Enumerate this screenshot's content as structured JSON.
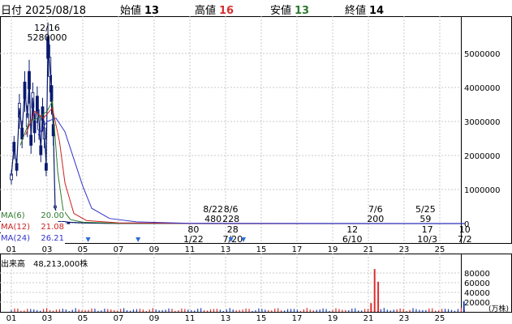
{
  "header": {
    "date": "日付 2025/08/18",
    "open_label": "始値",
    "open": "13",
    "high_label": "高値",
    "high": "16",
    "low_label": "安値",
    "low": "13",
    "close_label": "終値",
    "close": "14"
  },
  "ma": [
    {
      "label": "MA(6)",
      "value": "20.00",
      "color": "#2d7a2d"
    },
    {
      "label": "MA(12)",
      "value": "21.08",
      "color": "#cc2222"
    },
    {
      "label": "MA(24)",
      "value": "26.21",
      "color": "#3333cc"
    }
  ],
  "volume_label": "出来高　48,213,000株",
  "volume_unit": "(万株)",
  "colors": {
    "price": "#0a1a6e",
    "up": "#d93030",
    "down": "#2244bb",
    "grid": "#c8c8c8",
    "frame": "#000000"
  },
  "chart_data": {
    "type": "candlestick",
    "x_ticks": [
      "01",
      "03",
      "05",
      "07",
      "09",
      "11",
      "13",
      "15",
      "17",
      "19",
      "21",
      "23",
      "25"
    ],
    "y_ticks": [
      "0",
      "1000000",
      "2000000",
      "3000000",
      "4000000",
      "5000000"
    ],
    "ylim": [
      0,
      5500000
    ],
    "volume_ticks": [
      "20000",
      "40000",
      "60000",
      "80000"
    ],
    "volume_ylim": [
      0,
      92000
    ],
    "annotations": [
      {
        "label": "12/16",
        "value": "5280000",
        "x": 2,
        "y": 5280000
      },
      {
        "label": "8/22",
        "value": "480",
        "x": 11.3,
        "y": 480
      },
      {
        "label": "8/6",
        "value": "228",
        "x": 12.3,
        "y": 228
      },
      {
        "label": "80",
        "sub": "1/22",
        "x": 10.2,
        "y": 80
      },
      {
        "label": "28",
        "sub": "7/20",
        "x": 12.4,
        "y": 28
      },
      {
        "label": "12",
        "sub": "6/10",
        "x": 19.1,
        "y": 12
      },
      {
        "label": "7/6",
        "value": "200",
        "x": 20.4,
        "y": 200
      },
      {
        "label": "5/25",
        "value": "59",
        "x": 23.2,
        "y": 59
      },
      {
        "label": "17",
        "sub": "10/3",
        "x": 23.3,
        "y": 17
      },
      {
        "label": "10",
        "sub": "7/2",
        "x": 25.4,
        "y": 10
      }
    ],
    "markers_x": [
      4.3,
      7.1,
      12.3,
      13.0
    ],
    "price_series": [
      [
        0.0,
        1400000
      ],
      [
        0.15,
        2300000
      ],
      [
        0.3,
        1700000
      ],
      [
        0.45,
        3400000
      ],
      [
        0.6,
        2700000
      ],
      [
        0.75,
        4000000
      ],
      [
        0.9,
        3100000
      ],
      [
        1.0,
        4300000
      ],
      [
        1.1,
        2500000
      ],
      [
        1.2,
        3700000
      ],
      [
        1.3,
        2900000
      ],
      [
        1.45,
        3600000
      ],
      [
        1.55,
        3000000
      ],
      [
        1.65,
        2200000
      ],
      [
        1.75,
        3300000
      ],
      [
        1.85,
        2700000
      ],
      [
        1.95,
        1700000
      ],
      [
        2.05,
        5280000
      ],
      [
        2.15,
        4700000
      ],
      [
        2.25,
        3900000
      ],
      [
        2.35,
        2800000
      ],
      [
        2.45,
        500000
      ],
      [
        2.55,
        200000
      ],
      [
        2.7,
        100000
      ],
      [
        2.9,
        60000
      ],
      [
        3.2,
        40000
      ],
      [
        3.6,
        30000
      ],
      [
        4.0,
        20000
      ],
      [
        4.5,
        15000
      ],
      [
        5.0,
        10000
      ],
      [
        6.0,
        5000
      ],
      [
        8.0,
        2000
      ],
      [
        10.0,
        1000
      ],
      [
        12.0,
        480
      ],
      [
        14.0,
        150
      ],
      [
        16.0,
        80
      ],
      [
        18.0,
        40
      ],
      [
        20.0,
        200
      ],
      [
        22.0,
        40
      ],
      [
        24.0,
        59
      ],
      [
        25.4,
        14
      ]
    ],
    "series": [
      {
        "name": "MA(6)",
        "points": [
          [
            0.5,
            2300000
          ],
          [
            1.0,
            3000000
          ],
          [
            1.5,
            3100000
          ],
          [
            2.0,
            3300000
          ],
          [
            2.3,
            3600000
          ],
          [
            2.6,
            1500000
          ],
          [
            2.9,
            400000
          ],
          [
            3.3,
            120000
          ],
          [
            4.0,
            40000
          ],
          [
            6.0,
            8000
          ],
          [
            10.0,
            1000
          ],
          [
            25.4,
            20
          ]
        ]
      },
      {
        "name": "MA(12)",
        "points": [
          [
            0.8,
            2600000
          ],
          [
            1.3,
            3300000
          ],
          [
            1.8,
            3100000
          ],
          [
            2.3,
            3400000
          ],
          [
            2.7,
            2400000
          ],
          [
            3.0,
            1200000
          ],
          [
            3.5,
            300000
          ],
          [
            4.2,
            90000
          ],
          [
            6.0,
            20000
          ],
          [
            10.0,
            2000
          ],
          [
            25.4,
            21
          ]
        ]
      },
      {
        "name": "MA(24)",
        "points": [
          [
            1.5,
            2600000
          ],
          [
            2.0,
            3000000
          ],
          [
            2.5,
            3100000
          ],
          [
            3.0,
            2700000
          ],
          [
            3.5,
            1900000
          ],
          [
            4.0,
            1100000
          ],
          [
            4.5,
            450000
          ],
          [
            5.5,
            150000
          ],
          [
            7.0,
            50000
          ],
          [
            10.0,
            5000
          ],
          [
            25.4,
            26
          ]
        ]
      }
    ],
    "volume_highlights": [
      {
        "x": 20.35,
        "value": 88000
      },
      {
        "x": 20.55,
        "value": 62000
      },
      {
        "x": 20.15,
        "value": 18000
      },
      {
        "x": 25.35,
        "value": 22000
      }
    ]
  }
}
